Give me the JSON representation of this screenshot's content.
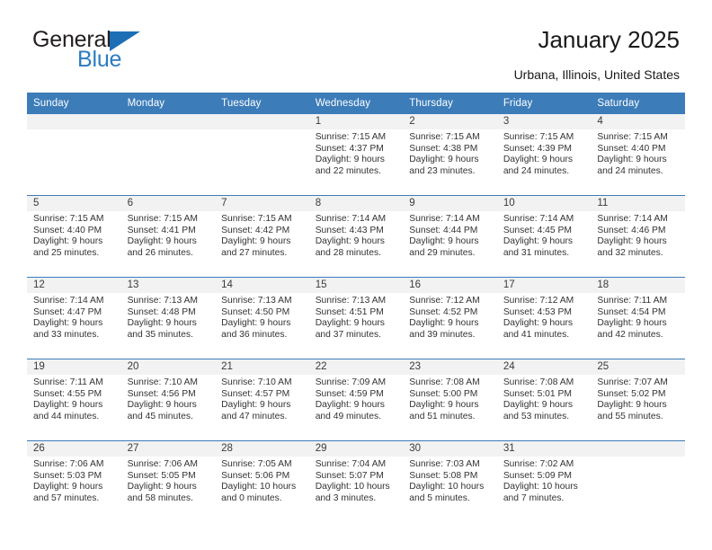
{
  "brand": {
    "logo_word_1": "General",
    "logo_word_2": "Blue",
    "triangle_icon": "blue-triangle-icon"
  },
  "header": {
    "title": "January 2025",
    "location": "Urbana, Illinois, United States"
  },
  "colors": {
    "header_blue": "#3c7cb9",
    "logo_blue": "#2b7cc0",
    "daynum_band": "#f2f2f2",
    "text": "#333333"
  },
  "calendar": {
    "weekday_headers": [
      "Sunday",
      "Monday",
      "Tuesday",
      "Wednesday",
      "Thursday",
      "Friday",
      "Saturday"
    ],
    "labels": {
      "sunrise": "Sunrise:",
      "sunset": "Sunset:",
      "daylight": "Daylight:"
    },
    "weeks": [
      [
        {
          "day": "",
          "empty": true
        },
        {
          "day": "",
          "empty": true
        },
        {
          "day": "",
          "empty": true
        },
        {
          "day": "1",
          "sunrise": "Sunrise: 7:15 AM",
          "sunset": "Sunset: 4:37 PM",
          "daylight_1": "Daylight: 9 hours",
          "daylight_2": "and 22 minutes."
        },
        {
          "day": "2",
          "sunrise": "Sunrise: 7:15 AM",
          "sunset": "Sunset: 4:38 PM",
          "daylight_1": "Daylight: 9 hours",
          "daylight_2": "and 23 minutes."
        },
        {
          "day": "3",
          "sunrise": "Sunrise: 7:15 AM",
          "sunset": "Sunset: 4:39 PM",
          "daylight_1": "Daylight: 9 hours",
          "daylight_2": "and 24 minutes."
        },
        {
          "day": "4",
          "sunrise": "Sunrise: 7:15 AM",
          "sunset": "Sunset: 4:40 PM",
          "daylight_1": "Daylight: 9 hours",
          "daylight_2": "and 24 minutes."
        }
      ],
      [
        {
          "day": "5",
          "sunrise": "Sunrise: 7:15 AM",
          "sunset": "Sunset: 4:40 PM",
          "daylight_1": "Daylight: 9 hours",
          "daylight_2": "and 25 minutes."
        },
        {
          "day": "6",
          "sunrise": "Sunrise: 7:15 AM",
          "sunset": "Sunset: 4:41 PM",
          "daylight_1": "Daylight: 9 hours",
          "daylight_2": "and 26 minutes."
        },
        {
          "day": "7",
          "sunrise": "Sunrise: 7:15 AM",
          "sunset": "Sunset: 4:42 PM",
          "daylight_1": "Daylight: 9 hours",
          "daylight_2": "and 27 minutes."
        },
        {
          "day": "8",
          "sunrise": "Sunrise: 7:14 AM",
          "sunset": "Sunset: 4:43 PM",
          "daylight_1": "Daylight: 9 hours",
          "daylight_2": "and 28 minutes."
        },
        {
          "day": "9",
          "sunrise": "Sunrise: 7:14 AM",
          "sunset": "Sunset: 4:44 PM",
          "daylight_1": "Daylight: 9 hours",
          "daylight_2": "and 29 minutes."
        },
        {
          "day": "10",
          "sunrise": "Sunrise: 7:14 AM",
          "sunset": "Sunset: 4:45 PM",
          "daylight_1": "Daylight: 9 hours",
          "daylight_2": "and 31 minutes."
        },
        {
          "day": "11",
          "sunrise": "Sunrise: 7:14 AM",
          "sunset": "Sunset: 4:46 PM",
          "daylight_1": "Daylight: 9 hours",
          "daylight_2": "and 32 minutes."
        }
      ],
      [
        {
          "day": "12",
          "sunrise": "Sunrise: 7:14 AM",
          "sunset": "Sunset: 4:47 PM",
          "daylight_1": "Daylight: 9 hours",
          "daylight_2": "and 33 minutes."
        },
        {
          "day": "13",
          "sunrise": "Sunrise: 7:13 AM",
          "sunset": "Sunset: 4:48 PM",
          "daylight_1": "Daylight: 9 hours",
          "daylight_2": "and 35 minutes."
        },
        {
          "day": "14",
          "sunrise": "Sunrise: 7:13 AM",
          "sunset": "Sunset: 4:50 PM",
          "daylight_1": "Daylight: 9 hours",
          "daylight_2": "and 36 minutes."
        },
        {
          "day": "15",
          "sunrise": "Sunrise: 7:13 AM",
          "sunset": "Sunset: 4:51 PM",
          "daylight_1": "Daylight: 9 hours",
          "daylight_2": "and 37 minutes."
        },
        {
          "day": "16",
          "sunrise": "Sunrise: 7:12 AM",
          "sunset": "Sunset: 4:52 PM",
          "daylight_1": "Daylight: 9 hours",
          "daylight_2": "and 39 minutes."
        },
        {
          "day": "17",
          "sunrise": "Sunrise: 7:12 AM",
          "sunset": "Sunset: 4:53 PM",
          "daylight_1": "Daylight: 9 hours",
          "daylight_2": "and 41 minutes."
        },
        {
          "day": "18",
          "sunrise": "Sunrise: 7:11 AM",
          "sunset": "Sunset: 4:54 PM",
          "daylight_1": "Daylight: 9 hours",
          "daylight_2": "and 42 minutes."
        }
      ],
      [
        {
          "day": "19",
          "sunrise": "Sunrise: 7:11 AM",
          "sunset": "Sunset: 4:55 PM",
          "daylight_1": "Daylight: 9 hours",
          "daylight_2": "and 44 minutes."
        },
        {
          "day": "20",
          "sunrise": "Sunrise: 7:10 AM",
          "sunset": "Sunset: 4:56 PM",
          "daylight_1": "Daylight: 9 hours",
          "daylight_2": "and 45 minutes."
        },
        {
          "day": "21",
          "sunrise": "Sunrise: 7:10 AM",
          "sunset": "Sunset: 4:57 PM",
          "daylight_1": "Daylight: 9 hours",
          "daylight_2": "and 47 minutes."
        },
        {
          "day": "22",
          "sunrise": "Sunrise: 7:09 AM",
          "sunset": "Sunset: 4:59 PM",
          "daylight_1": "Daylight: 9 hours",
          "daylight_2": "and 49 minutes."
        },
        {
          "day": "23",
          "sunrise": "Sunrise: 7:08 AM",
          "sunset": "Sunset: 5:00 PM",
          "daylight_1": "Daylight: 9 hours",
          "daylight_2": "and 51 minutes."
        },
        {
          "day": "24",
          "sunrise": "Sunrise: 7:08 AM",
          "sunset": "Sunset: 5:01 PM",
          "daylight_1": "Daylight: 9 hours",
          "daylight_2": "and 53 minutes."
        },
        {
          "day": "25",
          "sunrise": "Sunrise: 7:07 AM",
          "sunset": "Sunset: 5:02 PM",
          "daylight_1": "Daylight: 9 hours",
          "daylight_2": "and 55 minutes."
        }
      ],
      [
        {
          "day": "26",
          "sunrise": "Sunrise: 7:06 AM",
          "sunset": "Sunset: 5:03 PM",
          "daylight_1": "Daylight: 9 hours",
          "daylight_2": "and 57 minutes."
        },
        {
          "day": "27",
          "sunrise": "Sunrise: 7:06 AM",
          "sunset": "Sunset: 5:05 PM",
          "daylight_1": "Daylight: 9 hours",
          "daylight_2": "and 58 minutes."
        },
        {
          "day": "28",
          "sunrise": "Sunrise: 7:05 AM",
          "sunset": "Sunset: 5:06 PM",
          "daylight_1": "Daylight: 10 hours",
          "daylight_2": "and 0 minutes."
        },
        {
          "day": "29",
          "sunrise": "Sunrise: 7:04 AM",
          "sunset": "Sunset: 5:07 PM",
          "daylight_1": "Daylight: 10 hours",
          "daylight_2": "and 3 minutes."
        },
        {
          "day": "30",
          "sunrise": "Sunrise: 7:03 AM",
          "sunset": "Sunset: 5:08 PM",
          "daylight_1": "Daylight: 10 hours",
          "daylight_2": "and 5 minutes."
        },
        {
          "day": "31",
          "sunrise": "Sunrise: 7:02 AM",
          "sunset": "Sunset: 5:09 PM",
          "daylight_1": "Daylight: 10 hours",
          "daylight_2": "and 7 minutes."
        },
        {
          "day": "",
          "empty": true
        }
      ]
    ]
  }
}
